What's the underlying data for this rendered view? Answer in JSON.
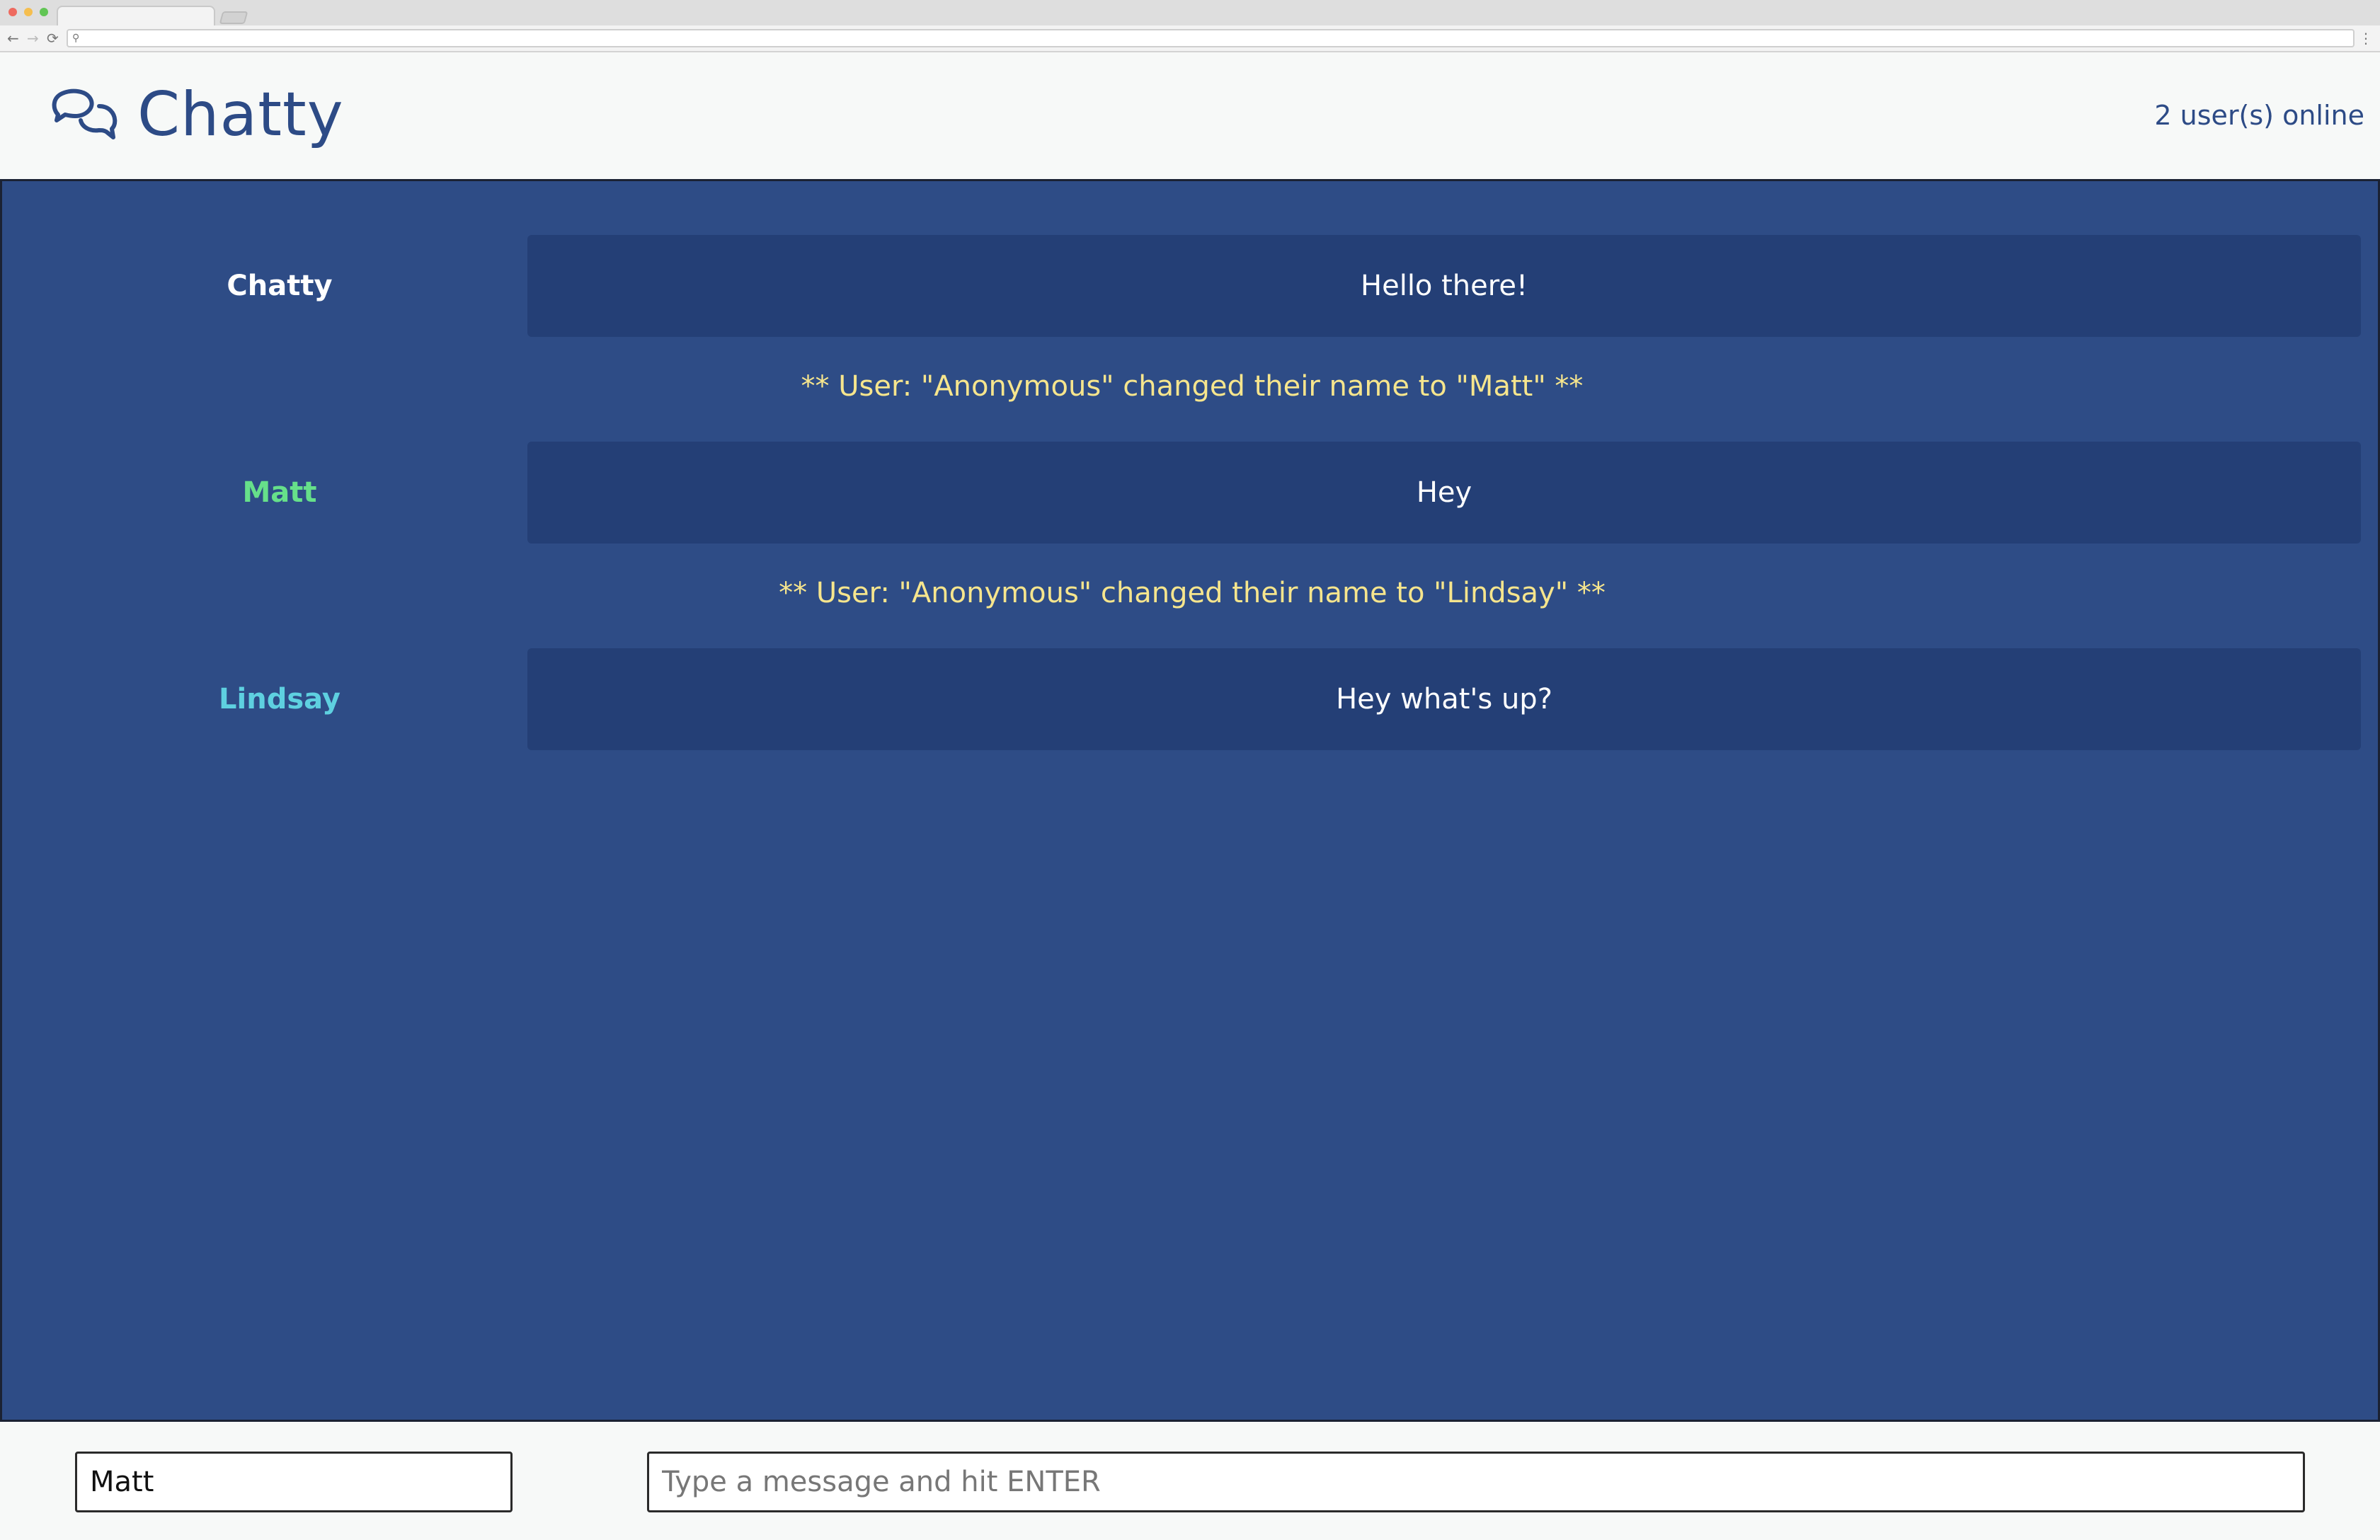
{
  "browser": {
    "nav_back": "←",
    "nav_forward": "→",
    "nav_reload": "⟳",
    "url_icon": "⚲",
    "menu": "⋮"
  },
  "navbar": {
    "brand_icon": "chat-bubbles-icon",
    "brand": "Chatty",
    "user_count": "2 user(s) online"
  },
  "messages": [
    {
      "type": "message",
      "username": "Chatty",
      "username_color": "#ffffff",
      "content": "Hello there!"
    },
    {
      "type": "notification",
      "content": "** User: \"Anonymous\" changed their name to \"Matt\" **"
    },
    {
      "type": "message",
      "username": "Matt",
      "username_color": "#66e08a",
      "content": "Hey"
    },
    {
      "type": "notification",
      "content": "** User: \"Anonymous\" changed their name to \"Lindsay\" **"
    },
    {
      "type": "message",
      "username": "Lindsay",
      "username_color": "#5ed0e0",
      "content": "Hey what's up?"
    }
  ],
  "chatbar": {
    "username_value": "Matt",
    "message_placeholder": "Type a message and hit ENTER"
  },
  "colors": {
    "brand": "#2d4b86",
    "messages_bg": "#2e4c86",
    "message_bubble": "#243f76",
    "notification_text": "#f6e58d"
  }
}
